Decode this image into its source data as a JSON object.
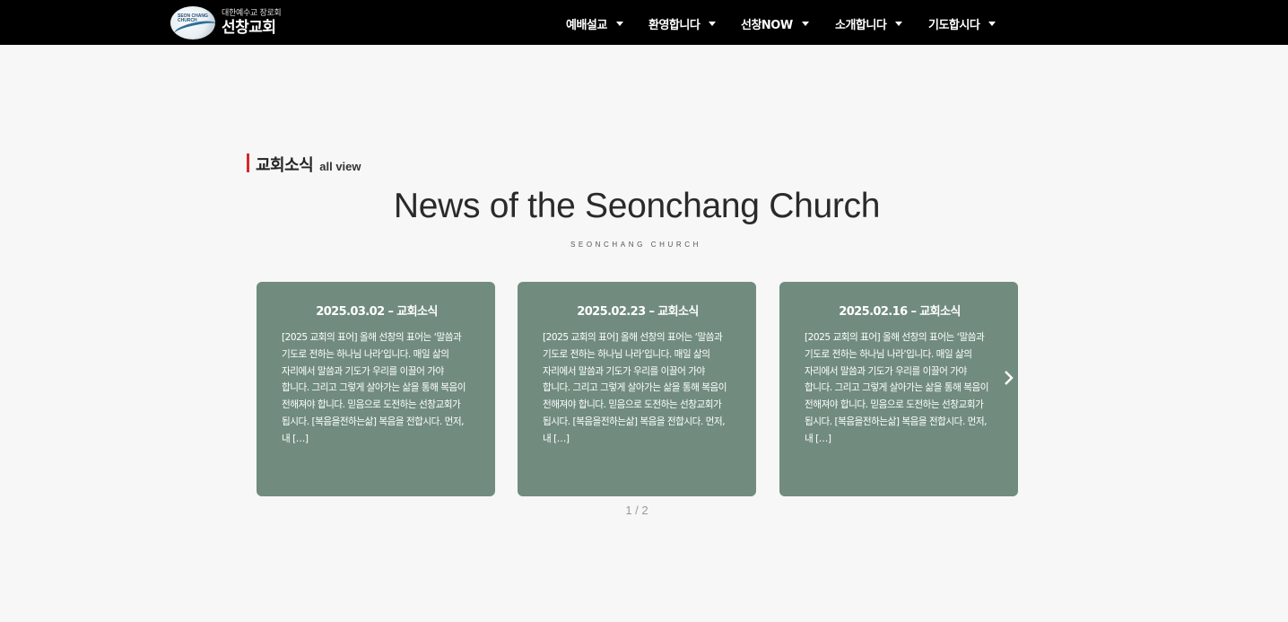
{
  "header": {
    "logo": {
      "badge_text": "SEON CHANG CHURCH",
      "subtitle": "대한예수교 장로회",
      "name": "선창교회"
    },
    "nav": [
      {
        "label": "예배설교"
      },
      {
        "label": "환영합니다"
      },
      {
        "label": "선창NOW"
      },
      {
        "label": "소개합니다"
      },
      {
        "label": "기도합시다"
      }
    ]
  },
  "section": {
    "title": "교회소식",
    "link": "all view",
    "heading": "News of the Seonchang Church",
    "subheading": "SEONCHANG CHURCH"
  },
  "cards": [
    {
      "title": "2025.03.02 – 교회소식",
      "body": "[2025 교회의 표어] 올해 선창의 표어는 ‘말씀과 기도로 전하는 하나님 나라’입니다. 매일 삶의 자리에서 말씀과 기도가 우리를 이끌어 가야 합니다. 그리고 그렇게 살아가는 삶을 통해 복음이 전해져야 합니다. 믿음으로 도전하는 선창교회가 됩시다. [복음을전하는삶] 복음을 전합시다. 먼저, 내 […]"
    },
    {
      "title": "2025.02.23 – 교회소식",
      "body": "[2025 교회의 표어] 올해 선창의 표어는 ‘말씀과 기도로 전하는 하나님 나라’입니다. 매일 삶의 자리에서 말씀과 기도가 우리를 이끌어 가야 합니다. 그리고 그렇게 살아가는 삶을 통해 복음이 전해져야 합니다. 믿음으로 도전하는 선창교회가 됩시다. [복음을전하는삶] 복음을 전합시다. 먼저, 내 […]"
    },
    {
      "title": "2025.02.16 – 교회소식",
      "body": "[2025 교회의 표어] 올해 선창의 표어는 ‘말씀과 기도로 전하는 하나님 나라’입니다. 매일 삶의 자리에서 말씀과 기도가 우리를 이끌어 가야 합니다. 그리고 그렇게 살아가는 삶을 통해 복음이 전해져야 합니다. 믿음으로 도전하는 선창교회가 됩시다. [복음을전하는삶] 복음을 전합시다. 먼저, 내 […]"
    }
  ],
  "carousel": {
    "pagination": "1 / 2",
    "prev_icon": "chevron-left-icon",
    "next_icon": "chevron-right-icon"
  },
  "colors": {
    "header_bg": "#000000",
    "card_bg": "#718c7f",
    "accent_bar": "#d62828",
    "page_bg": "#f7f7f7"
  }
}
